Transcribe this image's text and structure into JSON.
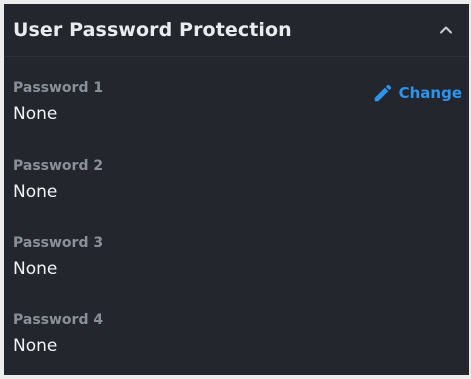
{
  "header": {
    "title": "User Password Protection",
    "collapse_icon": "chevron-up-icon"
  },
  "passwords": [
    {
      "label": "Password 1",
      "value": "None"
    },
    {
      "label": "Password 2",
      "value": "None"
    },
    {
      "label": "Password 3",
      "value": "None"
    },
    {
      "label": "Password 4",
      "value": "None"
    }
  ],
  "change": {
    "label": "Change",
    "icon": "pencil-icon"
  },
  "colors": {
    "panel_bg": "#23272d",
    "accent": "#2d95ef",
    "label": "#8a9099",
    "text": "#f2f3f5"
  }
}
